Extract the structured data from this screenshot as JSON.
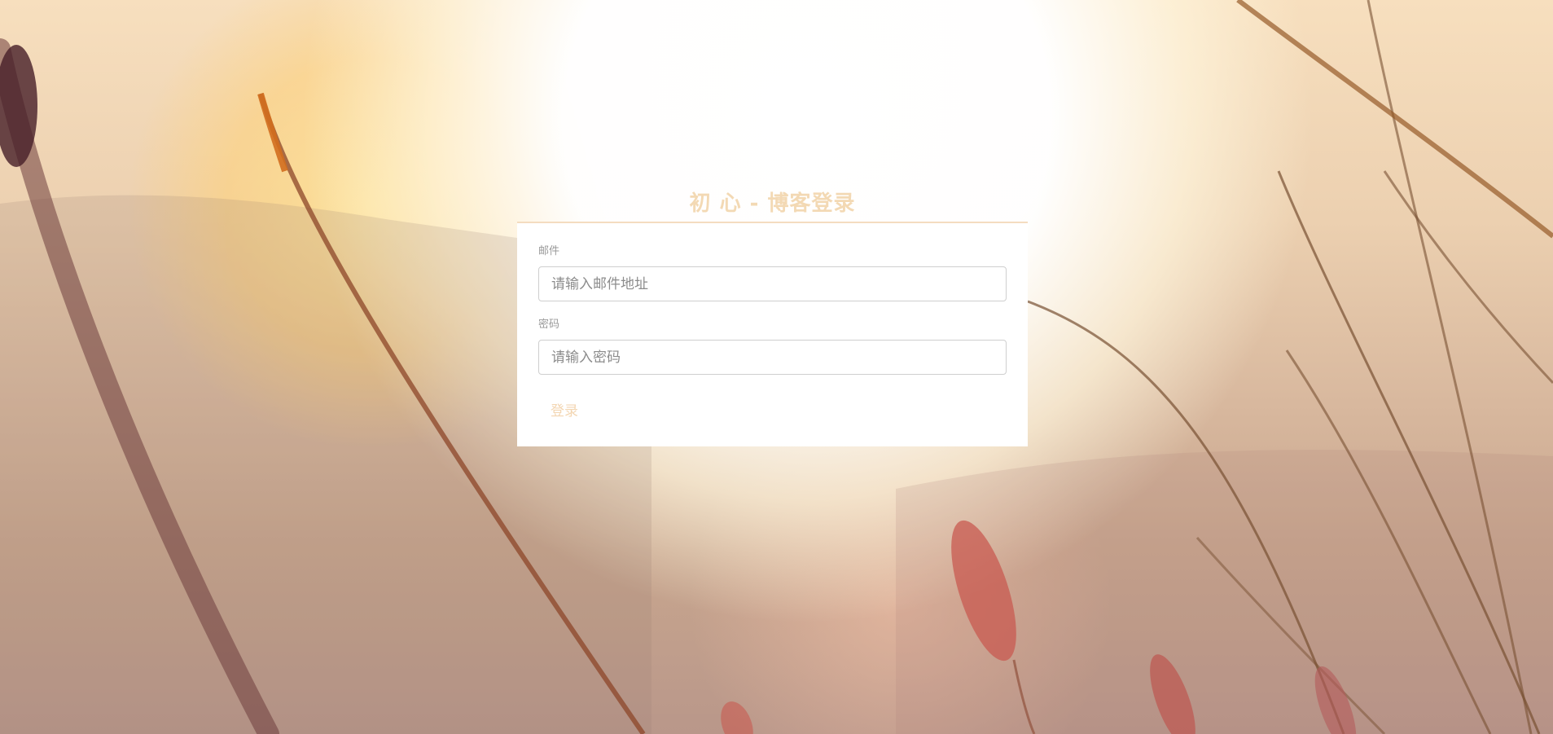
{
  "login": {
    "title": "初 心 - 博客登录",
    "email_label": "邮件",
    "email_placeholder": "请输入邮件地址",
    "email_value": "",
    "password_label": "密码",
    "password_placeholder": "请输入密码",
    "password_value": "",
    "submit_label": "登录"
  },
  "colors": {
    "title": "#f3d9b4",
    "panel_bg": "#ffffff",
    "button_text": "#f3d6b2",
    "label_text": "#9a9a9a"
  }
}
